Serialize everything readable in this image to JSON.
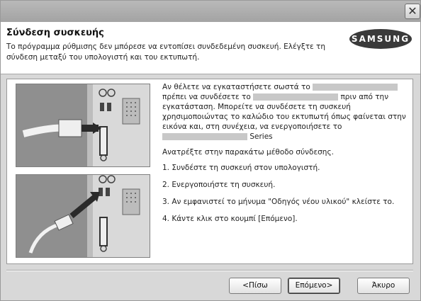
{
  "window": {
    "close_glyph": "✕"
  },
  "header": {
    "title": "Σύνδεση συσκευής",
    "description": "Το πρόγραμμα ρύθμισης δεν μπόρεσε να εντοπίσει συνδεδεμένη συσκευή. Ελέγξτε τη σύνδεση μεταξύ του υπολογιστή και του εκτυπωτή.",
    "logo_text": "SAMSUNG"
  },
  "instructions": {
    "p1_a": "Αν θέλετε να εγκαταστήσετε σωστά το",
    "p1_b": "πρέπει να συνδέσετε το",
    "p1_c": "πριν από την εγκατάσταση. Μπορείτε να συνδέσετε τη συσκευή χρησιμοποιώντας το καλώδιο του εκτυπωτή όπως φαίνεται στην εικόνα και, στη συνέχεια, να ενεργοποιήσετε το",
    "p1_d": "Series",
    "method_intro": "Ανατρέξτε στην παρακάτω μέθοδο σύνδεσης.",
    "steps": [
      "1. Συνδέστε τη συσκευή στον υπολογιστή.",
      "2. Ενεργοποιήστε τη συσκευή.",
      "3. Αν εμφανιστεί το μήνυμα \"Οδηγός νέου υλικού\" κλείστε το.",
      "4. Κάντε κλικ στο κουμπί [Επόμενο]."
    ]
  },
  "buttons": {
    "back": "<Πίσω",
    "next": "Επόμενο>",
    "cancel": "Άκυρο"
  }
}
